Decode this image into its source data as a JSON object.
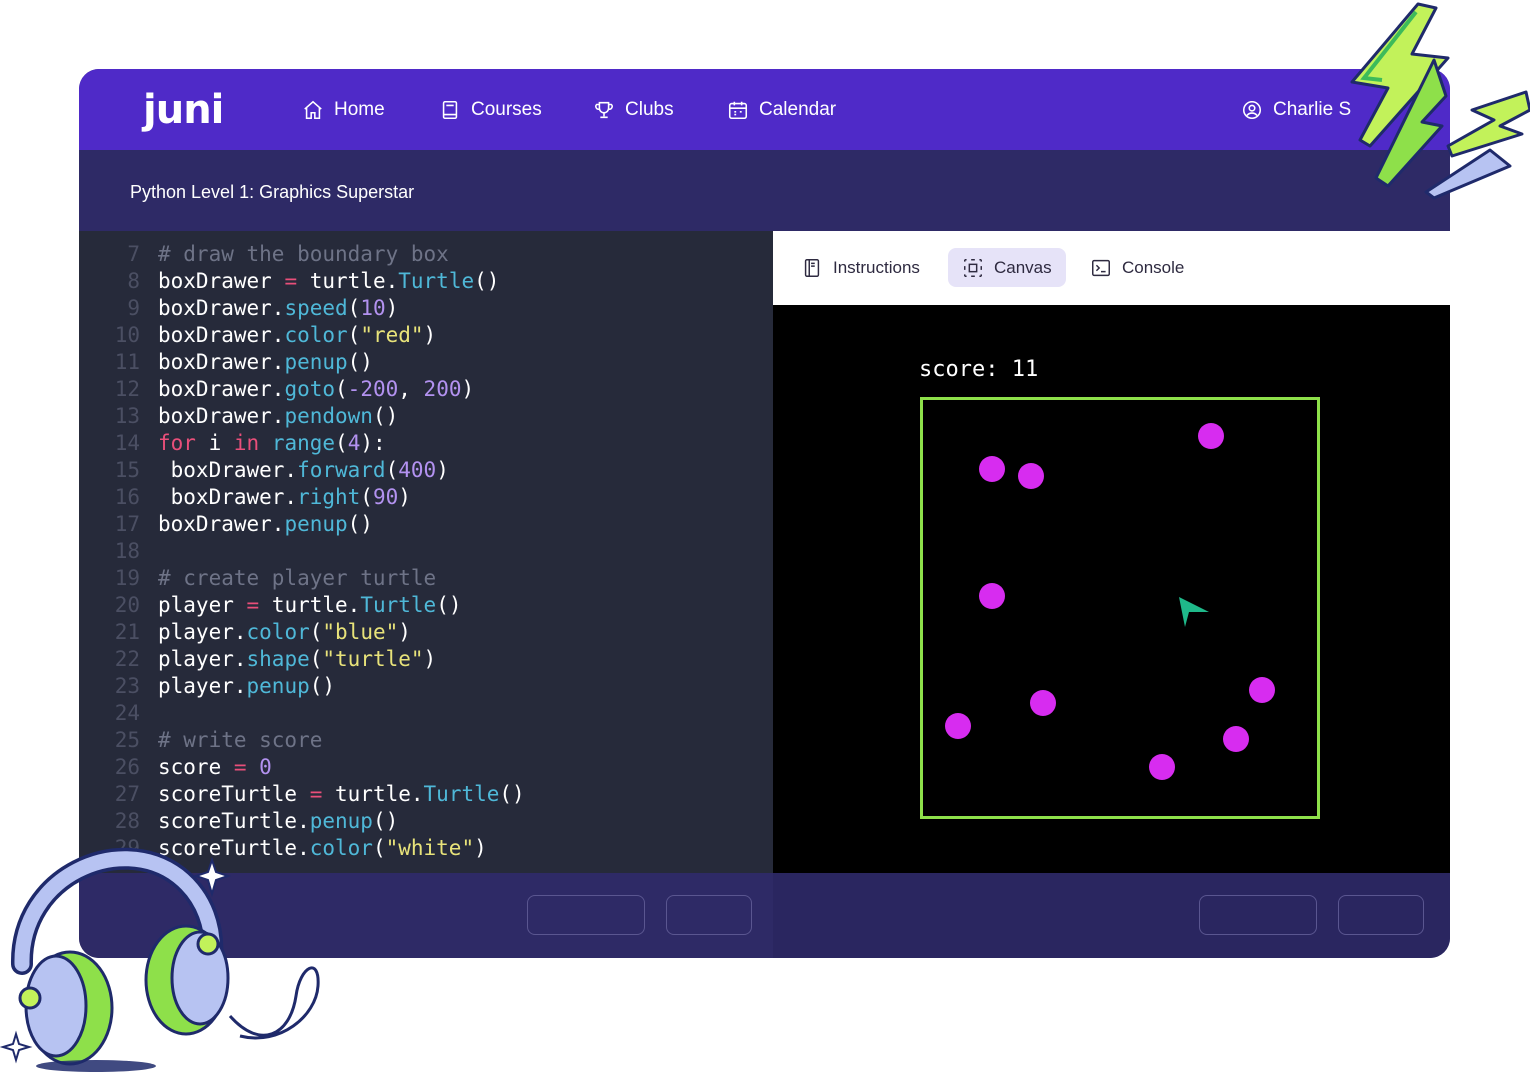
{
  "nav": {
    "logo": "juni",
    "items": [
      {
        "label": "Home",
        "icon": "home-icon"
      },
      {
        "label": "Courses",
        "icon": "book-icon"
      },
      {
        "label": "Clubs",
        "icon": "trophy-icon"
      },
      {
        "label": "Calendar",
        "icon": "calendar-icon"
      }
    ],
    "user": "Charlie S"
  },
  "course_title": "Python Level 1: Graphics Superstar",
  "editor": {
    "lines": [
      {
        "n": "7",
        "tokens": [
          [
            "cm",
            "# draw the boundary box"
          ]
        ]
      },
      {
        "n": "8",
        "tokens": [
          [
            "id",
            "boxDrawer "
          ],
          [
            "op",
            "="
          ],
          [
            "id",
            " turtle."
          ],
          [
            "fn",
            "Turtle"
          ],
          [
            "id",
            "()"
          ]
        ]
      },
      {
        "n": "9",
        "tokens": [
          [
            "id",
            "boxDrawer."
          ],
          [
            "fn",
            "speed"
          ],
          [
            "id",
            "("
          ],
          [
            "num",
            "10"
          ],
          [
            "id",
            ")"
          ]
        ]
      },
      {
        "n": "10",
        "tokens": [
          [
            "id",
            "boxDrawer."
          ],
          [
            "fn",
            "color"
          ],
          [
            "id",
            "("
          ],
          [
            "str",
            "\"red\""
          ],
          [
            "id",
            ")"
          ]
        ]
      },
      {
        "n": "11",
        "tokens": [
          [
            "id",
            "boxDrawer."
          ],
          [
            "fn",
            "penup"
          ],
          [
            "id",
            "()"
          ]
        ]
      },
      {
        "n": "12",
        "tokens": [
          [
            "id",
            "boxDrawer."
          ],
          [
            "fn",
            "goto"
          ],
          [
            "id",
            "("
          ],
          [
            "num",
            "-200"
          ],
          [
            "id",
            ", "
          ],
          [
            "num",
            "200"
          ],
          [
            "id",
            ")"
          ]
        ]
      },
      {
        "n": "13",
        "tokens": [
          [
            "id",
            "boxDrawer."
          ],
          [
            "fn",
            "pendown"
          ],
          [
            "id",
            "()"
          ]
        ]
      },
      {
        "n": "14",
        "tokens": [
          [
            "kw",
            "for"
          ],
          [
            "id",
            " i "
          ],
          [
            "kw",
            "in"
          ],
          [
            "id",
            " "
          ],
          [
            "fn",
            "range"
          ],
          [
            "id",
            "("
          ],
          [
            "num",
            "4"
          ],
          [
            "id",
            "):"
          ]
        ]
      },
      {
        "n": "15",
        "tokens": [
          [
            "id",
            " boxDrawer."
          ],
          [
            "fn",
            "forward"
          ],
          [
            "id",
            "("
          ],
          [
            "num",
            "400"
          ],
          [
            "id",
            ")"
          ]
        ]
      },
      {
        "n": "16",
        "tokens": [
          [
            "id",
            " boxDrawer."
          ],
          [
            "fn",
            "right"
          ],
          [
            "id",
            "("
          ],
          [
            "num",
            "90"
          ],
          [
            "id",
            ")"
          ]
        ]
      },
      {
        "n": "17",
        "tokens": [
          [
            "id",
            "boxDrawer."
          ],
          [
            "fn",
            "penup"
          ],
          [
            "id",
            "()"
          ]
        ]
      },
      {
        "n": "18",
        "tokens": []
      },
      {
        "n": "19",
        "tokens": [
          [
            "cm",
            "# create player turtle"
          ]
        ]
      },
      {
        "n": "20",
        "tokens": [
          [
            "id",
            "player "
          ],
          [
            "op",
            "="
          ],
          [
            "id",
            " turtle."
          ],
          [
            "fn",
            "Turtle"
          ],
          [
            "id",
            "()"
          ]
        ]
      },
      {
        "n": "21",
        "tokens": [
          [
            "id",
            "player."
          ],
          [
            "fn",
            "color"
          ],
          [
            "id",
            "("
          ],
          [
            "str",
            "\"blue\""
          ],
          [
            "id",
            ")"
          ]
        ]
      },
      {
        "n": "22",
        "tokens": [
          [
            "id",
            "player."
          ],
          [
            "fn",
            "shape"
          ],
          [
            "id",
            "("
          ],
          [
            "str",
            "\"turtle\""
          ],
          [
            "id",
            ")"
          ]
        ]
      },
      {
        "n": "23",
        "tokens": [
          [
            "id",
            "player."
          ],
          [
            "fn",
            "penup"
          ],
          [
            "id",
            "()"
          ]
        ]
      },
      {
        "n": "24",
        "tokens": []
      },
      {
        "n": "25",
        "tokens": [
          [
            "cm",
            "# write score"
          ]
        ]
      },
      {
        "n": "26",
        "tokens": [
          [
            "id",
            "score "
          ],
          [
            "op",
            "="
          ],
          [
            "id",
            " "
          ],
          [
            "num",
            "0"
          ]
        ]
      },
      {
        "n": "27",
        "tokens": [
          [
            "id",
            "scoreTurtle "
          ],
          [
            "op",
            "="
          ],
          [
            "id",
            " turtle."
          ],
          [
            "fn",
            "Turtle"
          ],
          [
            "id",
            "()"
          ]
        ]
      },
      {
        "n": "28",
        "tokens": [
          [
            "id",
            "scoreTurtle."
          ],
          [
            "fn",
            "penup"
          ],
          [
            "id",
            "()"
          ]
        ]
      },
      {
        "n": "29",
        "tokens": [
          [
            "id",
            "scoreTurtle."
          ],
          [
            "fn",
            "color"
          ],
          [
            "id",
            "("
          ],
          [
            "str",
            "\"white\""
          ],
          [
            "id",
            ")"
          ]
        ]
      }
    ]
  },
  "tabs": [
    {
      "label": "Instructions",
      "icon": "book-open-icon",
      "active": false
    },
    {
      "label": "Canvas",
      "icon": "canvas-icon",
      "active": true
    },
    {
      "label": "Console",
      "icon": "terminal-icon",
      "active": false
    }
  ],
  "canvas": {
    "score_text": "score: 11",
    "colors": {
      "boundary": "#8ee04a",
      "dot": "#d72cf0",
      "player": "#1fb98a"
    }
  },
  "colors": {
    "nav_bg": "#4f2ac8",
    "subheader_bg": "#2e2a66",
    "editor_bg": "#262a3a"
  }
}
